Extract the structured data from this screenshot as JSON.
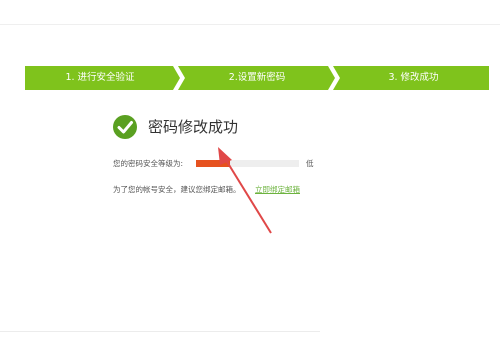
{
  "steps": [
    {
      "label": "1. 进行安全验证"
    },
    {
      "label": "2.设置新密码"
    },
    {
      "label": "3. 修改成功"
    }
  ],
  "success": {
    "title": "密码修改成功",
    "icon": "check-circle-icon",
    "color": "#5aa021"
  },
  "security": {
    "label": "您的密码安全等级为:",
    "level": "低",
    "strength_fraction": 0.33,
    "fill_color": "#e6521f"
  },
  "bind": {
    "tip": "为了您的帐号安全，建议您绑定邮箱。",
    "link": "立即绑定邮箱"
  },
  "colors": {
    "step_bar": "#7fc31c",
    "annotation_arrow": "#e04848"
  }
}
